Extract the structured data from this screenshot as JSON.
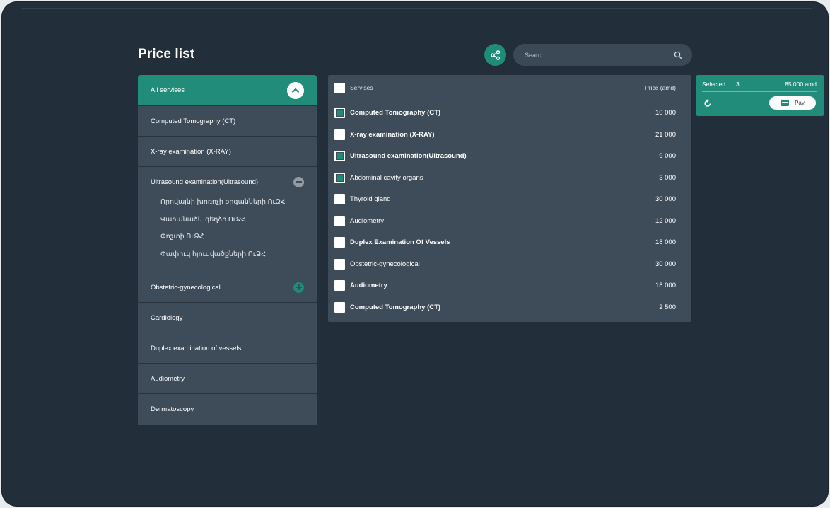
{
  "header": {
    "title": "Price list",
    "search_placeholder": "Search"
  },
  "sidebar": {
    "items": [
      {
        "label": "All servises"
      },
      {
        "label": "Computed Tomography (CT)"
      },
      {
        "label": "X-ray examination (X-RAY)"
      },
      {
        "label": "Ultrasound examination(Ultrasound)",
        "subitems": [
          "Որովայնի խոռոչի օրգանների ՈւՁՀ",
          "Վահանաձև գեղձի ՈւՁՀ",
          "Փոշտի ՈւՁՀ",
          "Փափուկ հյուսվածքների ՈւՁՀ"
        ]
      },
      {
        "label": "Obstetric-gynecological"
      },
      {
        "label": "Cardiology"
      },
      {
        "label": "Duplex examination of vessels"
      },
      {
        "label": "Audiometry"
      },
      {
        "label": "Dermatoscopy"
      }
    ]
  },
  "table": {
    "header_service": "Servises",
    "header_price": "Price (amd)",
    "rows": [
      {
        "name": "Computed Tomography (CT)",
        "price": "10 000",
        "checked": true,
        "bold": true
      },
      {
        "name": "X-ray examination (X-RAY)",
        "price": "21 000",
        "checked": false,
        "bold": true
      },
      {
        "name": "Ultrasound examination(Ultrasound)",
        "price": "9 000",
        "checked": true,
        "bold": true
      },
      {
        "name": "Abdominal cavity organs",
        "price": "3 000",
        "checked": true,
        "bold": false
      },
      {
        "name": "Thyroid gland",
        "price": "30 000",
        "checked": false,
        "bold": false
      },
      {
        "name": "Audiometry",
        "price": "12 000",
        "checked": false,
        "bold": false
      },
      {
        "name": "Duplex Examination Of Vessels",
        "price": "18 000",
        "checked": false,
        "bold": true
      },
      {
        "name": "Obstetric-gynecological",
        "price": "30 000",
        "checked": false,
        "bold": false
      },
      {
        "name": "Audiometry",
        "price": "18 000",
        "checked": false,
        "bold": true
      },
      {
        "name": "Computed Tomography (CT)",
        "price": "2 500",
        "checked": false,
        "bold": true
      }
    ]
  },
  "summary": {
    "selected_label": "Selected",
    "selected_count": "3",
    "total": "85 000 amd",
    "pay_label": "Pay"
  },
  "colors": {
    "background": "#222e39",
    "panel": "#3e4b58",
    "accent": "#218c79"
  }
}
